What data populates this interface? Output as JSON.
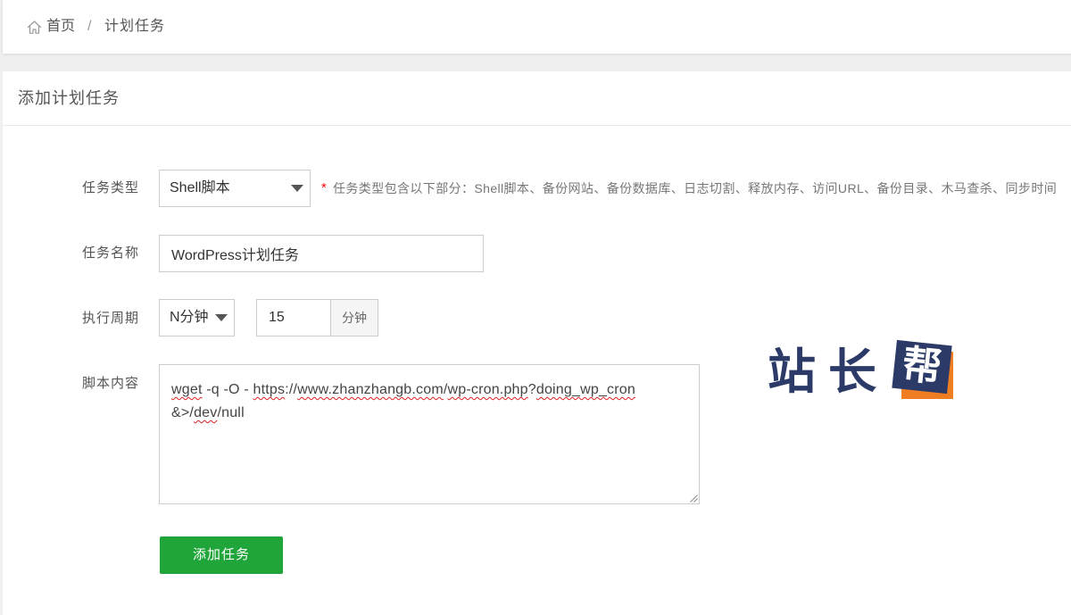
{
  "breadcrumb": {
    "home_icon": "home-icon",
    "home": "首页",
    "separator": "/",
    "current": "计划任务"
  },
  "panel": {
    "title": "添加计划任务"
  },
  "form": {
    "task_type": {
      "label": "任务类型",
      "selected": "Shell脚本",
      "dropdown_icon": "caret-down-icon",
      "required_mark": "*",
      "hint": "任务类型包含以下部分：Shell脚本、备份网站、备份数据库、日志切割、释放内存、访问URL、备份目录、木马查杀、同步时间"
    },
    "task_name": {
      "label": "任务名称",
      "value": "WordPress计划任务"
    },
    "schedule": {
      "label": "执行周期",
      "period_selected": "N分钟",
      "dropdown_icon": "caret-down-icon",
      "interval_value": "15",
      "interval_unit": "分钟"
    },
    "script": {
      "label": "脚本内容",
      "resize_icon": "resize-handle-icon",
      "segments": [
        {
          "text": "wget",
          "spellcheck_underline": true
        },
        {
          "text": " -q -O - "
        },
        {
          "text": "https",
          "spellcheck_underline": true
        },
        {
          "text": "://"
        },
        {
          "text": "www.zhanzhangb.com",
          "spellcheck_underline": true
        },
        {
          "text": "/"
        },
        {
          "text": "wp-cron.php",
          "spellcheck_underline": true
        },
        {
          "text": "?"
        },
        {
          "text": "doing_wp_cron",
          "spellcheck_underline": true
        },
        {
          "text": " &>/"
        },
        {
          "text": "dev",
          "spellcheck_underline": true
        },
        {
          "text": "/null"
        }
      ]
    },
    "submit_label": "添加任务"
  },
  "watermark": {
    "text": "站长",
    "badge_text": "帮"
  },
  "colors": {
    "accent": "#20a53a",
    "required": "#ef0808",
    "watermark_navy": "#2b3a67",
    "watermark_orange": "#ef7d22"
  }
}
